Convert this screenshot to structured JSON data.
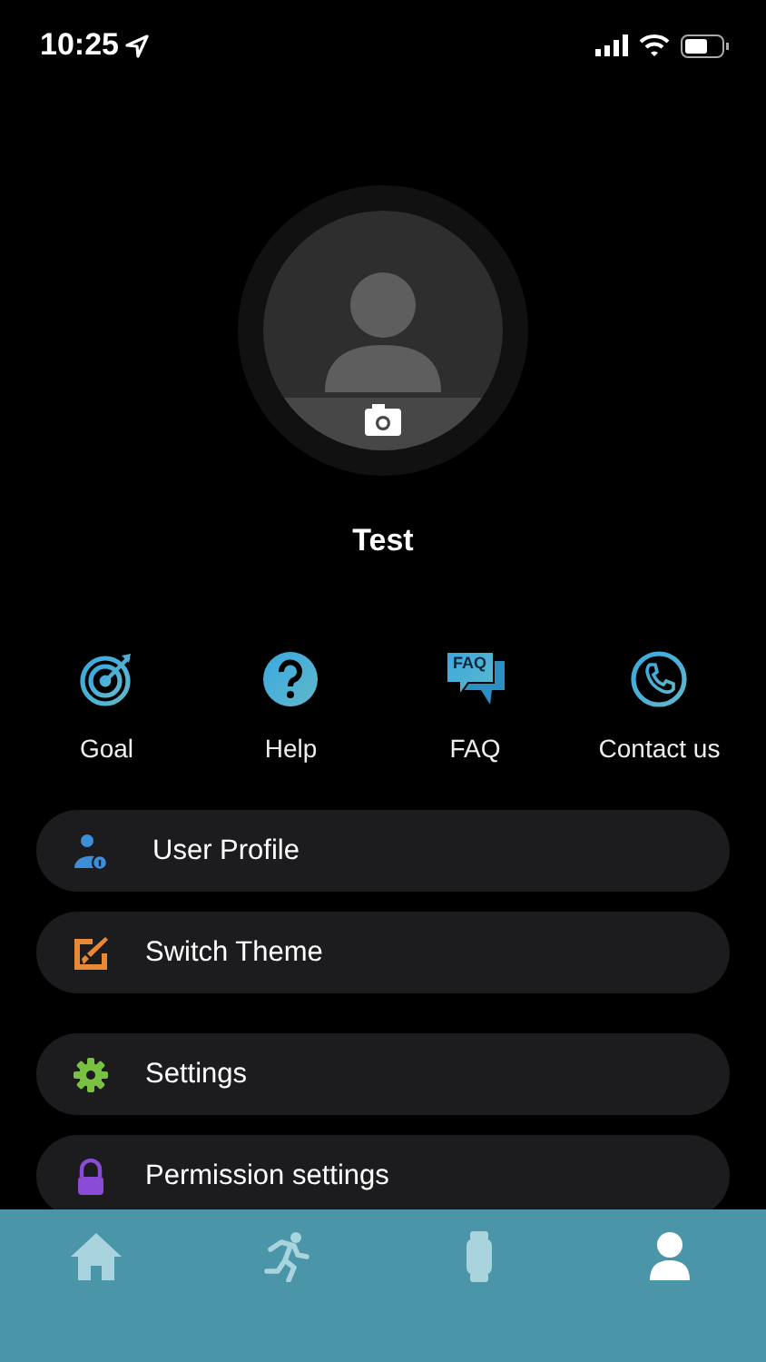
{
  "status_bar": {
    "time": "10:25"
  },
  "profile": {
    "name": "Test"
  },
  "shortcuts": [
    {
      "kind": "goal",
      "label": "Goal"
    },
    {
      "kind": "help",
      "label": "Help"
    },
    {
      "kind": "faq",
      "label": "FAQ",
      "icon_text": "FAQ"
    },
    {
      "kind": "contact",
      "label": "Contact us"
    }
  ],
  "menu_groups": [
    [
      {
        "kind": "profile",
        "label": "User Profile"
      },
      {
        "kind": "theme",
        "label": "Switch Theme"
      }
    ],
    [
      {
        "kind": "settings",
        "label": "Settings"
      },
      {
        "kind": "permission",
        "label": "Permission settings"
      }
    ]
  ],
  "tab_bar": [
    {
      "kind": "home",
      "selected": false
    },
    {
      "kind": "activity",
      "selected": false
    },
    {
      "kind": "device",
      "selected": false
    },
    {
      "kind": "me",
      "selected": true
    }
  ]
}
